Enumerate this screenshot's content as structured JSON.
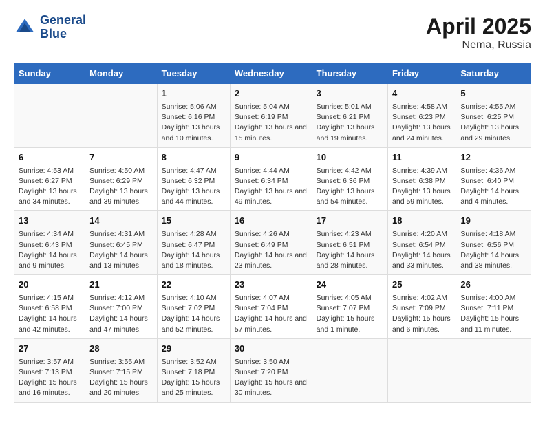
{
  "header": {
    "logo_line1": "General",
    "logo_line2": "Blue",
    "main_title": "April 2025",
    "sub_title": "Nema, Russia"
  },
  "calendar": {
    "days_of_week": [
      "Sunday",
      "Monday",
      "Tuesday",
      "Wednesday",
      "Thursday",
      "Friday",
      "Saturday"
    ],
    "weeks": [
      [
        {
          "day": "",
          "info": ""
        },
        {
          "day": "",
          "info": ""
        },
        {
          "day": "1",
          "info": "Sunrise: 5:06 AM\nSunset: 6:16 PM\nDaylight: 13 hours and 10 minutes."
        },
        {
          "day": "2",
          "info": "Sunrise: 5:04 AM\nSunset: 6:19 PM\nDaylight: 13 hours and 15 minutes."
        },
        {
          "day": "3",
          "info": "Sunrise: 5:01 AM\nSunset: 6:21 PM\nDaylight: 13 hours and 19 minutes."
        },
        {
          "day": "4",
          "info": "Sunrise: 4:58 AM\nSunset: 6:23 PM\nDaylight: 13 hours and 24 minutes."
        },
        {
          "day": "5",
          "info": "Sunrise: 4:55 AM\nSunset: 6:25 PM\nDaylight: 13 hours and 29 minutes."
        }
      ],
      [
        {
          "day": "6",
          "info": "Sunrise: 4:53 AM\nSunset: 6:27 PM\nDaylight: 13 hours and 34 minutes."
        },
        {
          "day": "7",
          "info": "Sunrise: 4:50 AM\nSunset: 6:29 PM\nDaylight: 13 hours and 39 minutes."
        },
        {
          "day": "8",
          "info": "Sunrise: 4:47 AM\nSunset: 6:32 PM\nDaylight: 13 hours and 44 minutes."
        },
        {
          "day": "9",
          "info": "Sunrise: 4:44 AM\nSunset: 6:34 PM\nDaylight: 13 hours and 49 minutes."
        },
        {
          "day": "10",
          "info": "Sunrise: 4:42 AM\nSunset: 6:36 PM\nDaylight: 13 hours and 54 minutes."
        },
        {
          "day": "11",
          "info": "Sunrise: 4:39 AM\nSunset: 6:38 PM\nDaylight: 13 hours and 59 minutes."
        },
        {
          "day": "12",
          "info": "Sunrise: 4:36 AM\nSunset: 6:40 PM\nDaylight: 14 hours and 4 minutes."
        }
      ],
      [
        {
          "day": "13",
          "info": "Sunrise: 4:34 AM\nSunset: 6:43 PM\nDaylight: 14 hours and 9 minutes."
        },
        {
          "day": "14",
          "info": "Sunrise: 4:31 AM\nSunset: 6:45 PM\nDaylight: 14 hours and 13 minutes."
        },
        {
          "day": "15",
          "info": "Sunrise: 4:28 AM\nSunset: 6:47 PM\nDaylight: 14 hours and 18 minutes."
        },
        {
          "day": "16",
          "info": "Sunrise: 4:26 AM\nSunset: 6:49 PM\nDaylight: 14 hours and 23 minutes."
        },
        {
          "day": "17",
          "info": "Sunrise: 4:23 AM\nSunset: 6:51 PM\nDaylight: 14 hours and 28 minutes."
        },
        {
          "day": "18",
          "info": "Sunrise: 4:20 AM\nSunset: 6:54 PM\nDaylight: 14 hours and 33 minutes."
        },
        {
          "day": "19",
          "info": "Sunrise: 4:18 AM\nSunset: 6:56 PM\nDaylight: 14 hours and 38 minutes."
        }
      ],
      [
        {
          "day": "20",
          "info": "Sunrise: 4:15 AM\nSunset: 6:58 PM\nDaylight: 14 hours and 42 minutes."
        },
        {
          "day": "21",
          "info": "Sunrise: 4:12 AM\nSunset: 7:00 PM\nDaylight: 14 hours and 47 minutes."
        },
        {
          "day": "22",
          "info": "Sunrise: 4:10 AM\nSunset: 7:02 PM\nDaylight: 14 hours and 52 minutes."
        },
        {
          "day": "23",
          "info": "Sunrise: 4:07 AM\nSunset: 7:04 PM\nDaylight: 14 hours and 57 minutes."
        },
        {
          "day": "24",
          "info": "Sunrise: 4:05 AM\nSunset: 7:07 PM\nDaylight: 15 hours and 1 minute."
        },
        {
          "day": "25",
          "info": "Sunrise: 4:02 AM\nSunset: 7:09 PM\nDaylight: 15 hours and 6 minutes."
        },
        {
          "day": "26",
          "info": "Sunrise: 4:00 AM\nSunset: 7:11 PM\nDaylight: 15 hours and 11 minutes."
        }
      ],
      [
        {
          "day": "27",
          "info": "Sunrise: 3:57 AM\nSunset: 7:13 PM\nDaylight: 15 hours and 16 minutes."
        },
        {
          "day": "28",
          "info": "Sunrise: 3:55 AM\nSunset: 7:15 PM\nDaylight: 15 hours and 20 minutes."
        },
        {
          "day": "29",
          "info": "Sunrise: 3:52 AM\nSunset: 7:18 PM\nDaylight: 15 hours and 25 minutes."
        },
        {
          "day": "30",
          "info": "Sunrise: 3:50 AM\nSunset: 7:20 PM\nDaylight: 15 hours and 30 minutes."
        },
        {
          "day": "",
          "info": ""
        },
        {
          "day": "",
          "info": ""
        },
        {
          "day": "",
          "info": ""
        }
      ]
    ]
  }
}
